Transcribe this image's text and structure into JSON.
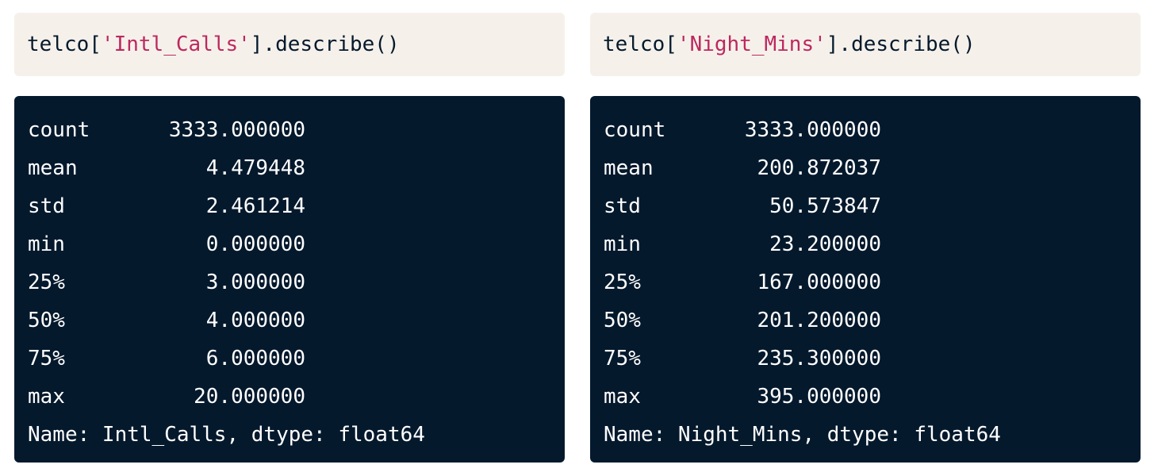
{
  "colors": {
    "code_bg": "#f5f1ea",
    "output_bg": "#05192d",
    "string_color": "#bd2860",
    "output_text": "#ffffff"
  },
  "left": {
    "code": {
      "prefix": "telco[",
      "string": "'Intl_Calls'",
      "suffix": "].describe()"
    },
    "output": {
      "rows": [
        {
          "label": "count",
          "value": "3333.000000"
        },
        {
          "label": "mean",
          "value": "4.479448"
        },
        {
          "label": "std",
          "value": "2.461214"
        },
        {
          "label": "min",
          "value": "0.000000"
        },
        {
          "label": "25%",
          "value": "3.000000"
        },
        {
          "label": "50%",
          "value": "4.000000"
        },
        {
          "label": "75%",
          "value": "6.000000"
        },
        {
          "label": "max",
          "value": "20.000000"
        }
      ],
      "footer": "Name: Intl_Calls, dtype: float64"
    }
  },
  "right": {
    "code": {
      "prefix": "telco[",
      "string": "'Night_Mins'",
      "suffix": "].describe()"
    },
    "output": {
      "rows": [
        {
          "label": "count",
          "value": "3333.000000"
        },
        {
          "label": "mean",
          "value": "200.872037"
        },
        {
          "label": "std",
          "value": "50.573847"
        },
        {
          "label": "min",
          "value": "23.200000"
        },
        {
          "label": "25%",
          "value": "167.000000"
        },
        {
          "label": "50%",
          "value": "201.200000"
        },
        {
          "label": "75%",
          "value": "235.300000"
        },
        {
          "label": "max",
          "value": "395.000000"
        }
      ],
      "footer": "Name: Night_Mins, dtype: float64"
    }
  }
}
